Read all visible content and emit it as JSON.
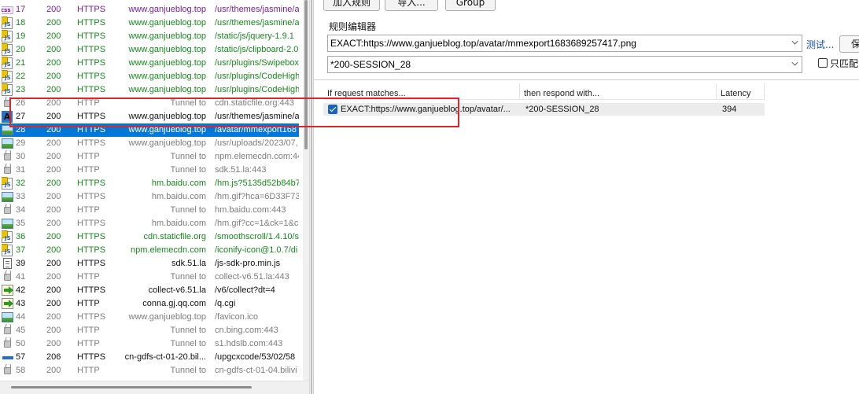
{
  "sessions": [
    {
      "icon": "css",
      "num": "17",
      "result": "200",
      "protocol": "HTTPS",
      "host": "www.ganjueblog.top",
      "url": "/usr/themes/jasmine/a",
      "color": "purple"
    },
    {
      "icon": "js",
      "num": "18",
      "result": "200",
      "protocol": "HTTPS",
      "host": "www.ganjueblog.top",
      "url": "/usr/themes/jasmine/a",
      "color": "green"
    },
    {
      "icon": "js",
      "num": "19",
      "result": "200",
      "protocol": "HTTPS",
      "host": "www.ganjueblog.top",
      "url": "/static/js/jquery-1.9.1",
      "color": "green"
    },
    {
      "icon": "js",
      "num": "20",
      "result": "200",
      "protocol": "HTTPS",
      "host": "www.ganjueblog.top",
      "url": "/static/js/clipboard-2.0",
      "color": "green"
    },
    {
      "icon": "js",
      "num": "21",
      "result": "200",
      "protocol": "HTTPS",
      "host": "www.ganjueblog.top",
      "url": "/usr/plugins/Swipebox",
      "color": "green"
    },
    {
      "icon": "js",
      "num": "22",
      "result": "200",
      "protocol": "HTTPS",
      "host": "www.ganjueblog.top",
      "url": "/usr/plugins/CodeHigh",
      "color": "green"
    },
    {
      "icon": "js",
      "num": "23",
      "result": "200",
      "protocol": "HTTPS",
      "host": "www.ganjueblog.top",
      "url": "/usr/plugins/CodeHigh",
      "color": "green"
    },
    {
      "icon": "lock",
      "num": "26",
      "result": "200",
      "protocol": "HTTP",
      "host": "Tunnel to",
      "url": "cdn.staticfile.org:443",
      "color": "gray"
    },
    {
      "icon": "A",
      "num": "27",
      "result": "200",
      "protocol": "HTTPS",
      "host": "www.ganjueblog.top",
      "url": "/usr/themes/jasmine/a",
      "color": "black"
    },
    {
      "icon": "img",
      "num": "28",
      "result": "200",
      "protocol": "HTTPS",
      "host": "www.ganjueblog.top",
      "url": "/avatar/mmexport168",
      "color": "selected"
    },
    {
      "icon": "img",
      "num": "29",
      "result": "200",
      "protocol": "HTTPS",
      "host": "www.ganjueblog.top",
      "url": "/usr/uploads/2023/07,",
      "color": "gray"
    },
    {
      "icon": "lock",
      "num": "30",
      "result": "200",
      "protocol": "HTTP",
      "host": "Tunnel to",
      "url": "npm.elemecdn.com:44",
      "color": "gray"
    },
    {
      "icon": "lock",
      "num": "31",
      "result": "200",
      "protocol": "HTTP",
      "host": "Tunnel to",
      "url": "sdk.51.la:443",
      "color": "gray"
    },
    {
      "icon": "js",
      "num": "32",
      "result": "200",
      "protocol": "HTTPS",
      "host": "hm.baidu.com",
      "url": "/hm.js?5135d52b84b7",
      "color": "green"
    },
    {
      "icon": "img",
      "num": "33",
      "result": "200",
      "protocol": "HTTPS",
      "host": "hm.baidu.com",
      "url": "/hm.gif?hca=6D33F73",
      "color": "gray"
    },
    {
      "icon": "lock",
      "num": "34",
      "result": "200",
      "protocol": "HTTP",
      "host": "Tunnel to",
      "url": "hm.baidu.com:443",
      "color": "gray"
    },
    {
      "icon": "img",
      "num": "35",
      "result": "200",
      "protocol": "HTTPS",
      "host": "hm.baidu.com",
      "url": "/hm.gif?cc=1&ck=1&c",
      "color": "gray"
    },
    {
      "icon": "js",
      "num": "36",
      "result": "200",
      "protocol": "HTTPS",
      "host": "cdn.staticfile.org",
      "url": "/smoothscroll/1.4.10/s",
      "color": "green"
    },
    {
      "icon": "js",
      "num": "37",
      "result": "200",
      "protocol": "HTTPS",
      "host": "npm.elemecdn.com",
      "url": "/iconify-icon@1.0.7/di",
      "color": "green"
    },
    {
      "icon": "doc",
      "num": "39",
      "result": "200",
      "protocol": "HTTPS",
      "host": "sdk.51.la",
      "url": "/js-sdk-pro.min.js",
      "color": "black"
    },
    {
      "icon": "lock",
      "num": "41",
      "result": "200",
      "protocol": "HTTP",
      "host": "Tunnel to",
      "url": "collect-v6.51.la:443",
      "color": "gray"
    },
    {
      "icon": "post",
      "num": "42",
      "result": "200",
      "protocol": "HTTPS",
      "host": "collect-v6.51.la",
      "url": "/v6/collect?dt=4",
      "color": "black"
    },
    {
      "icon": "post",
      "num": "43",
      "result": "200",
      "protocol": "HTTP",
      "host": "conna.gj.qq.com",
      "url": "/q.cgi",
      "color": "black"
    },
    {
      "icon": "img",
      "num": "44",
      "result": "200",
      "protocol": "HTTPS",
      "host": "www.ganjueblog.top",
      "url": "/favicon.ico",
      "color": "gray"
    },
    {
      "icon": "lock",
      "num": "45",
      "result": "200",
      "protocol": "HTTP",
      "host": "Tunnel to",
      "url": "cn.bing.com:443",
      "color": "gray"
    },
    {
      "icon": "lock",
      "num": "50",
      "result": "200",
      "protocol": "HTTP",
      "host": "Tunnel to",
      "url": "s1.hdslb.com:443",
      "color": "gray"
    },
    {
      "icon": "bar",
      "num": "57",
      "result": "206",
      "protocol": "HTTPS",
      "host": "cn-gdfs-ct-01-20.bil...",
      "url": "/upgcxcode/53/02/58",
      "color": "black"
    },
    {
      "icon": "lock",
      "num": "58",
      "result": "200",
      "protocol": "HTTP",
      "host": "Tunnel to",
      "url": "cn-gdfs-ct-01-04.bilivi",
      "color": "gray"
    }
  ],
  "toolbar": {
    "add_rule": "加入规则",
    "import": "导入...",
    "group": "Group"
  },
  "editor": {
    "label": "规则编辑器",
    "match_value": "EXACT:https://www.ganjueblog.top/avatar/mmexport1683689257417.png",
    "respond_value": "*200-SESSION_28",
    "test_link": "测试...",
    "save": "保",
    "only_match_label": "只匹配"
  },
  "rules_table": {
    "headers": {
      "match": "If request matches...",
      "respond": "then respond with...",
      "latency": "Latency"
    },
    "rows": [
      {
        "match": "EXACT:https://www.ganjueblog.top/avatar/...",
        "respond": "*200-SESSION_28",
        "latency": "394",
        "enabled": true
      }
    ]
  },
  "colors": {
    "selection": "#0078d7",
    "success_green": "#17891c",
    "tunnel_gray": "#7d7d7d",
    "css_purple": "#7d1b9c",
    "highlight_red": "#d8282f",
    "link_blue": "#1a4fb5"
  }
}
